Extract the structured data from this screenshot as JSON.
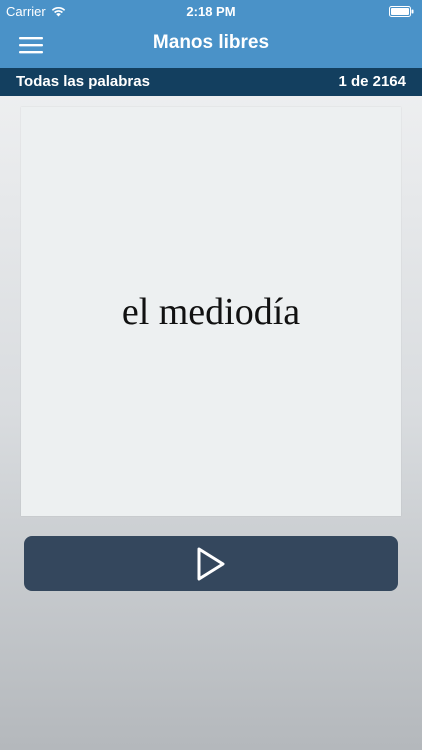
{
  "status_bar": {
    "carrier": "Carrier",
    "time": "2:18 PM"
  },
  "nav": {
    "title": "Manos libres"
  },
  "subheader": {
    "list_name": "Todas las palabras",
    "counter": "1 de 2164"
  },
  "card": {
    "word": "el mediodía"
  },
  "colors": {
    "nav_blue": "#4a92c8",
    "subheader_navy": "#133f5f",
    "card_bg": "#edf0f1",
    "play_button": "#34475d"
  },
  "icons": {
    "menu": "hamburger-menu-icon",
    "play": "play-icon",
    "wifi": "wifi-icon",
    "battery": "battery-icon"
  }
}
